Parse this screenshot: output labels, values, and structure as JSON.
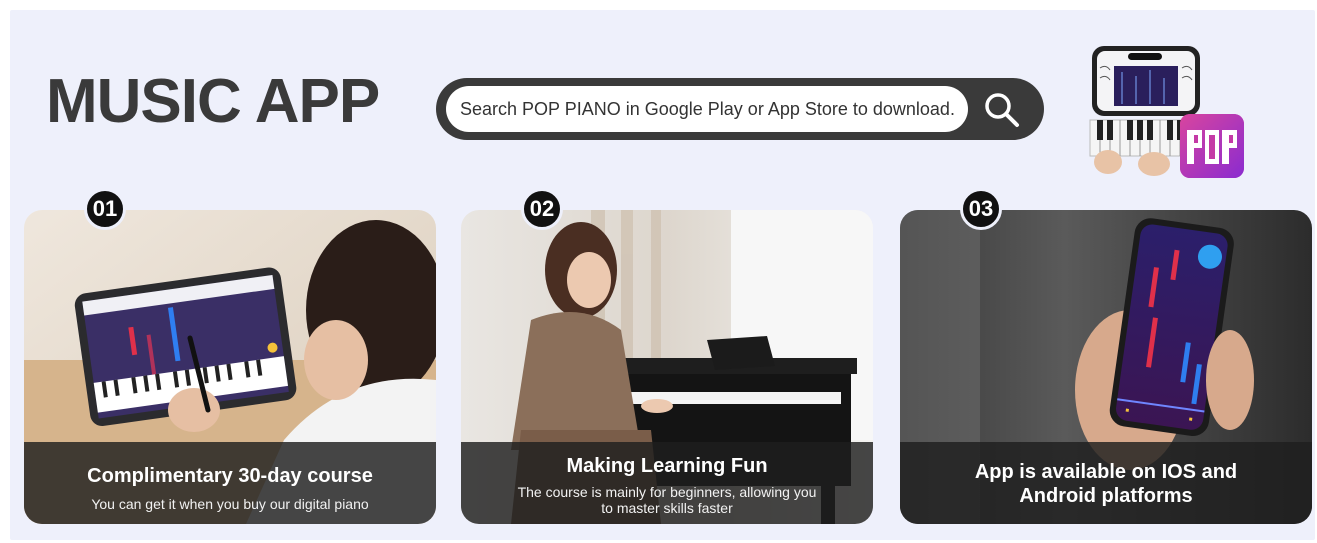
{
  "header": {
    "title": "MUSIC APP"
  },
  "search": {
    "text": "Search POP PIANO in Google Play or App Store to download.",
    "icon": "search-icon"
  },
  "app_badge": {
    "icon": "pop-app-icon",
    "accent": "#c43aa6"
  },
  "cards": [
    {
      "number": "01",
      "title": "Complimentary 30-day course",
      "subtitle": "You can get it when you buy our digital piano"
    },
    {
      "number": "02",
      "title": "Making Learning Fun",
      "subtitle": "The course is mainly for beginners, allowing you to master skills faster"
    },
    {
      "number": "03",
      "title": "App is available on IOS and Android platforms",
      "subtitle": ""
    }
  ],
  "colors": {
    "background": "#eef0fb",
    "dark": "#3a3a3a",
    "caption_bg": "#1e1e1e",
    "note_blue": "#2f7ef0",
    "note_red": "#e0304a"
  }
}
